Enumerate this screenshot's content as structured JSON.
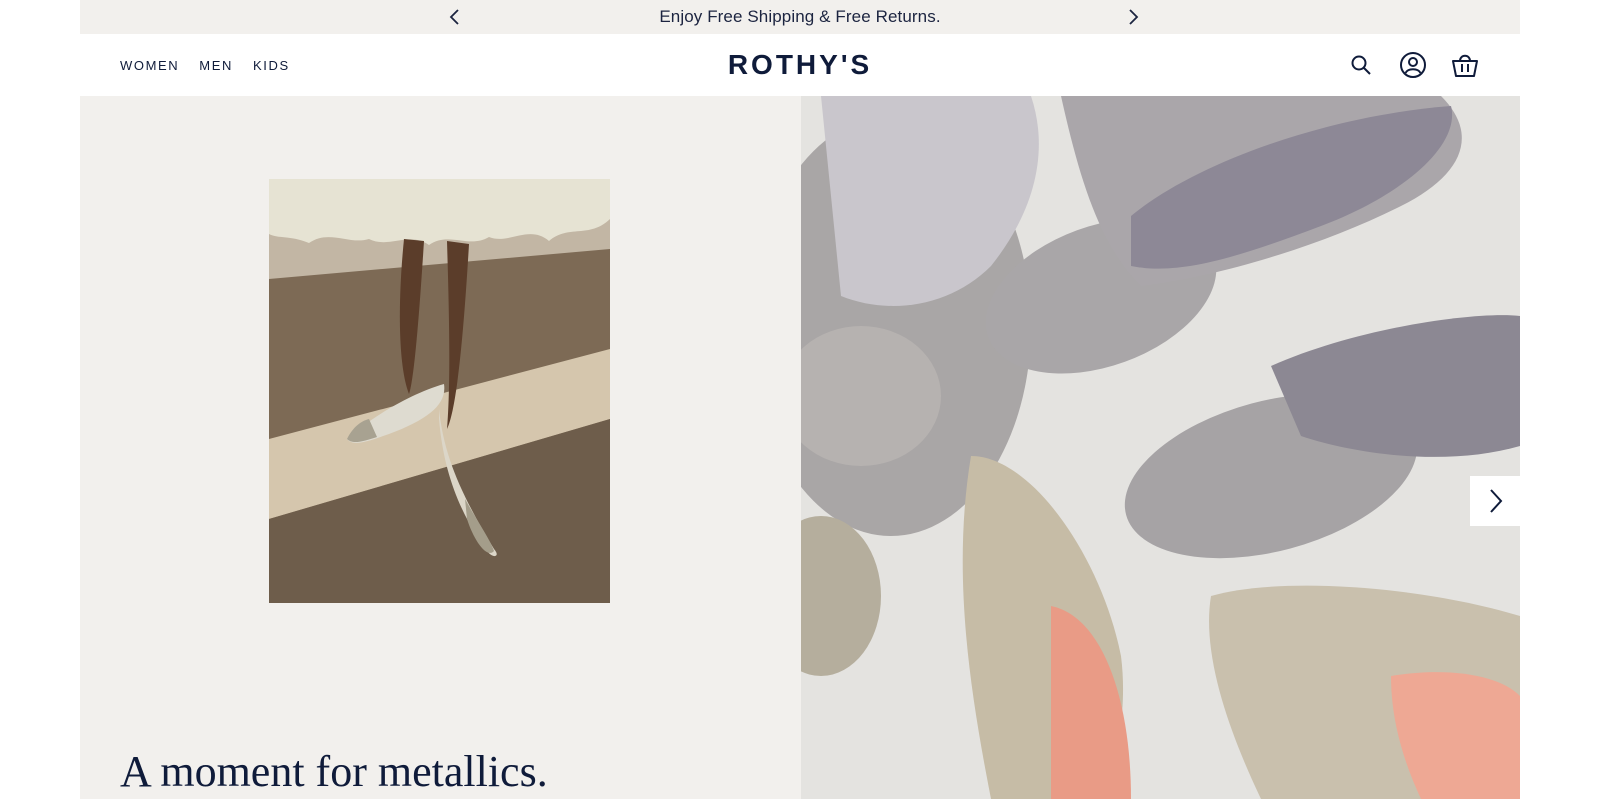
{
  "announcement": {
    "message": "Enjoy Free Shipping & Free Returns.",
    "prev_icon": "chevron-left-icon",
    "next_icon": "chevron-right-icon"
  },
  "nav": {
    "items": [
      {
        "label": "WOMEN"
      },
      {
        "label": "MEN"
      },
      {
        "label": "KIDS"
      }
    ]
  },
  "brand": {
    "logo": "ROTHY'S"
  },
  "header_icons": [
    "search-icon",
    "account-icon",
    "cart-icon"
  ],
  "hero": {
    "headline": "A moment for metallics.",
    "carousel_next_icon": "chevron-right-icon"
  },
  "colors": {
    "navy": "#0f1b3a",
    "announcement_bg": "#f2f0ed",
    "hero_left_bg": "#f2f0ed"
  }
}
